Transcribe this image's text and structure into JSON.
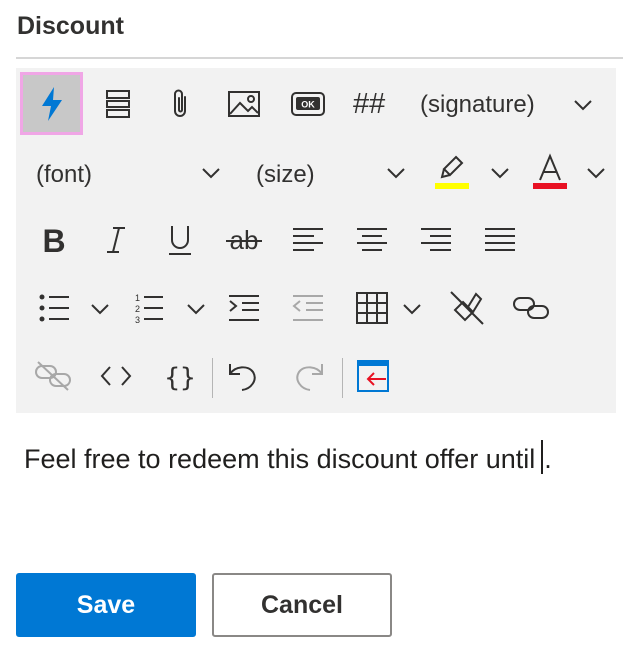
{
  "field": {
    "title": "Discount"
  },
  "toolbar": {
    "signature_label": "(signature)",
    "font_label": "(font)",
    "size_label": "(size)",
    "hash_label": "##",
    "ok_label": "OK",
    "highlight_color": "#ffff00",
    "font_color": "#e81123",
    "accent_color": "#0078d4",
    "icons": [
      "quick-parts-icon",
      "insert-text-block-icon",
      "attachment-icon",
      "image-icon",
      "ok-button-icon",
      "hashtag-icon",
      "bold-icon",
      "italic-icon",
      "underline-icon",
      "strikethrough-icon",
      "align-left-icon",
      "align-center-icon",
      "align-right-icon",
      "justify-icon",
      "bullet-list-icon",
      "numbered-list-icon",
      "indent-icon",
      "outdent-icon",
      "table-icon",
      "clear-formatting-icon",
      "link-icon",
      "unlink-icon",
      "code-view-icon",
      "braces-icon",
      "undo-icon",
      "redo-icon",
      "insert-field-icon"
    ]
  },
  "editor": {
    "text": "Feel free to redeem this discount offer until",
    "text_after_caret": "."
  },
  "actions": {
    "save_label": "Save",
    "cancel_label": "Cancel"
  }
}
